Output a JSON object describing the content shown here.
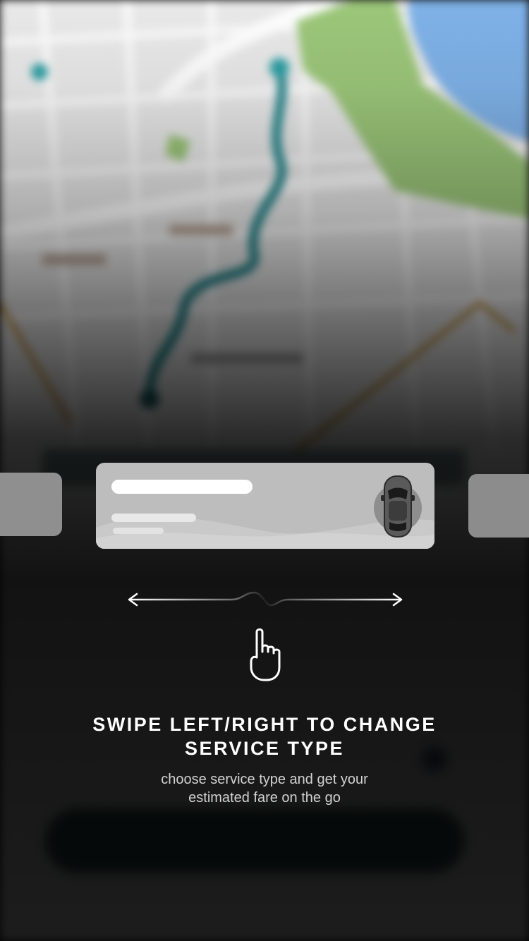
{
  "onboarding": {
    "title_line1": "SWIPE LEFT/RIGHT TO CHANGE",
    "title_line2": "SERVICE TYPE",
    "subtitle_line1": "choose service type and get your",
    "subtitle_line2": "estimated fare on the go"
  },
  "icons": {
    "swipe": "left-right-arrow-icon",
    "gesture": "hand-pointer-icon",
    "vehicle": "car-top-view-icon"
  },
  "colors": {
    "route": "#2d8a8f",
    "park": "#9cc77a",
    "water": "#7fb2e8",
    "card": "#bdbdbd",
    "text": "#ffffff"
  }
}
